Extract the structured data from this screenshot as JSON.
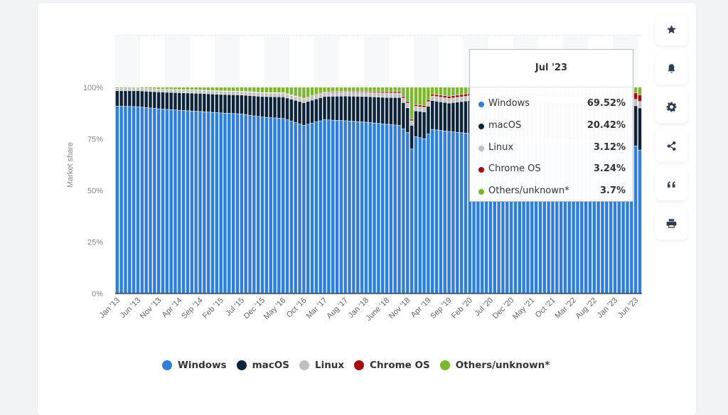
{
  "toolbar": {
    "items": [
      {
        "name": "favorite",
        "icon": "star-icon"
      },
      {
        "name": "notify",
        "icon": "bell-icon"
      },
      {
        "name": "settings",
        "icon": "gear-icon"
      },
      {
        "name": "share",
        "icon": "share-icon"
      },
      {
        "name": "cite",
        "icon": "quote-icon"
      },
      {
        "name": "print",
        "icon": "printer-icon"
      }
    ]
  },
  "tooltip": {
    "title": "Jul '23",
    "rows": [
      {
        "label": "Windows",
        "value": "69.52%",
        "color": "#2f7ed8"
      },
      {
        "label": "macOS",
        "value": "20.42%",
        "color": "#0d233a"
      },
      {
        "label": "Linux",
        "value": "3.12%",
        "color": "#c0c0c0"
      },
      {
        "label": "Chrome OS",
        "value": "3.24%",
        "color": "#a50d0d"
      },
      {
        "label": "Others/unknown*",
        "value": "3.7%",
        "color": "#7cb72d"
      }
    ]
  },
  "legend": [
    {
      "label": "Windows",
      "color": "#2f7ed8"
    },
    {
      "label": "macOS",
      "color": "#0d233a"
    },
    {
      "label": "Linux",
      "color": "#c0c0c0"
    },
    {
      "label": "Chrome OS",
      "color": "#a50d0d"
    },
    {
      "label": "Others/unknown*",
      "color": "#7cb72d"
    }
  ],
  "chart_data": {
    "type": "bar",
    "stacked": true,
    "title": "",
    "xlabel": "",
    "ylabel": "Market share",
    "ylim": [
      0,
      100
    ],
    "yticks": [
      "0%",
      "25%",
      "50%",
      "75%",
      "100%"
    ],
    "grid": false,
    "legend_position": "bottom",
    "x_start": "Jan 2013",
    "x_end": "Jul 2023",
    "x_count": 127,
    "xtick_labels": [
      "Jan '13",
      "Jun '13",
      "Nov '13",
      "Apr '14",
      "Sep '14",
      "Feb '15",
      "Jul '15",
      "Dec '15",
      "May '16",
      "Oct '16",
      "Mar '17",
      "Aug '17",
      "Jan '18",
      "June '18",
      "Nov '18",
      "Apr '19",
      "Sep '19",
      "Feb '20",
      "Jul '20",
      "Dec '20",
      "May '21",
      "Oct '21",
      "Mar '22",
      "Aug '22",
      "Jan '23",
      "Jun '23"
    ],
    "xtick_every": 5,
    "series_names": [
      "Windows",
      "macOS",
      "Linux",
      "Chrome OS",
      "Others/unknown*"
    ],
    "series_colors": [
      "#2f7ed8",
      "#0d233a",
      "#c0c0c0",
      "#a50d0d",
      "#7cb72d"
    ],
    "windows_keypoints": [
      [
        0,
        90.8
      ],
      [
        5,
        90.5
      ],
      [
        10,
        89.5
      ],
      [
        15,
        88.8
      ],
      [
        20,
        88.2
      ],
      [
        25,
        87.5
      ],
      [
        30,
        87.0
      ],
      [
        35,
        85.5
      ],
      [
        40,
        84.8
      ],
      [
        45,
        81.5
      ],
      [
        50,
        84.2
      ],
      [
        55,
        83.7
      ],
      [
        60,
        83.0
      ],
      [
        65,
        82.0
      ],
      [
        68,
        81.5
      ],
      [
        70,
        78.0
      ],
      [
        71,
        70.0
      ],
      [
        72,
        76.0
      ],
      [
        74,
        75.0
      ],
      [
        76,
        79.5
      ],
      [
        80,
        78.5
      ],
      [
        85,
        77.5
      ],
      [
        90,
        76.5
      ],
      [
        95,
        75.5
      ],
      [
        100,
        76.0
      ],
      [
        105,
        75.0
      ],
      [
        110,
        74.5
      ],
      [
        115,
        74.0
      ],
      [
        120,
        73.0
      ],
      [
        125,
        71.5
      ],
      [
        126,
        69.52
      ]
    ],
    "macos_keypoints": [
      [
        0,
        7.5
      ],
      [
        5,
        7.8
      ],
      [
        10,
        8.2
      ],
      [
        15,
        8.5
      ],
      [
        20,
        8.8
      ],
      [
        25,
        9.0
      ],
      [
        30,
        9.2
      ],
      [
        35,
        10.0
      ],
      [
        40,
        10.5
      ],
      [
        45,
        11.0
      ],
      [
        50,
        11.3
      ],
      [
        55,
        12.0
      ],
      [
        60,
        12.5
      ],
      [
        65,
        13.0
      ],
      [
        68,
        13.5
      ],
      [
        70,
        12.0
      ],
      [
        71,
        11.5
      ],
      [
        72,
        12.5
      ],
      [
        74,
        13.0
      ],
      [
        76,
        14.0
      ],
      [
        80,
        13.8
      ],
      [
        85,
        16.0
      ],
      [
        90,
        17.0
      ],
      [
        95,
        17.5
      ],
      [
        100,
        17.2
      ],
      [
        105,
        17.5
      ],
      [
        110,
        18.0
      ],
      [
        115,
        18.5
      ],
      [
        120,
        19.0
      ],
      [
        125,
        19.5
      ],
      [
        126,
        20.42
      ]
    ],
    "linux_keypoints": [
      [
        0,
        1.2
      ],
      [
        20,
        1.5
      ],
      [
        40,
        1.8
      ],
      [
        60,
        2.0
      ],
      [
        70,
        2.2
      ],
      [
        90,
        2.3
      ],
      [
        110,
        2.7
      ],
      [
        126,
        3.12
      ]
    ],
    "chromeos_keypoints": [
      [
        0,
        0
      ],
      [
        40,
        0.2
      ],
      [
        60,
        0.5
      ],
      [
        70,
        0.8
      ],
      [
        85,
        1.2
      ],
      [
        100,
        1.5
      ],
      [
        110,
        2.0
      ],
      [
        120,
        2.5
      ],
      [
        126,
        3.24
      ]
    ],
    "series": [
      {
        "name": "Windows",
        "last_value": 69.52
      },
      {
        "name": "macOS",
        "last_value": 20.42
      },
      {
        "name": "Linux",
        "last_value": 3.12
      },
      {
        "name": "Chrome OS",
        "last_value": 3.24
      },
      {
        "name": "Others/unknown*",
        "last_value": 3.7
      }
    ],
    "note": "Others/unknown* = remainder to 100%"
  }
}
